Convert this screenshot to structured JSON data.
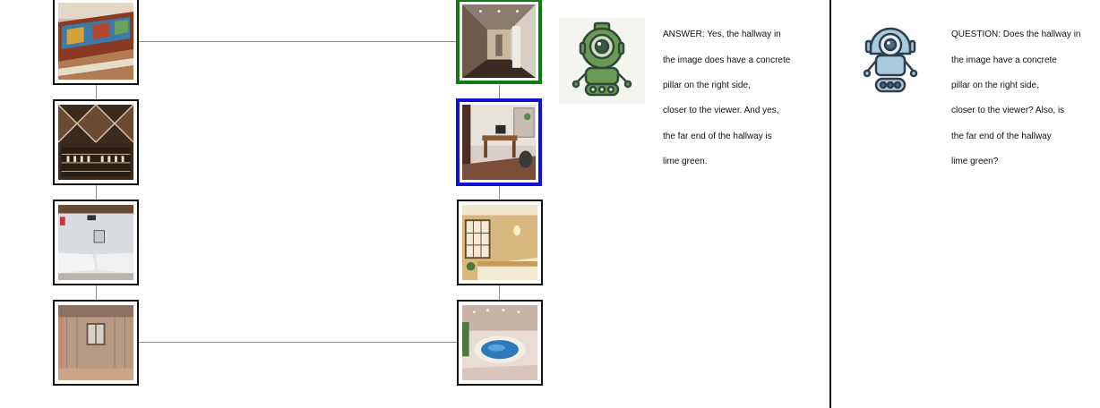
{
  "colors": {
    "selected_primary": "#127a12",
    "selected_secondary": "#1010d8",
    "frame_border": "#111111",
    "connector": "#8c8c8c",
    "answerer_robot": "#6a9a54",
    "questioner_robot": "#a9c9dc"
  },
  "gallery": {
    "left_column": [
      {
        "scene": "lobby-with-mural"
      },
      {
        "scene": "wine-cellar"
      },
      {
        "scene": "bedroom-with-twin-beds"
      },
      {
        "scene": "unfinished-wooden-room"
      }
    ],
    "right_column": [
      {
        "scene": "hallway",
        "selection": "green"
      },
      {
        "scene": "home-office",
        "selection": "blue"
      },
      {
        "scene": "bedroom-with-shoji-screens"
      },
      {
        "scene": "indoor-pool"
      }
    ]
  },
  "chat": {
    "answerer": {
      "icon": "green-robot-icon",
      "lines": [
        "ANSWER: Yes, the hallway in",
        "the image does have a concrete",
        "pillar on the right side,",
        "closer to the viewer. And yes,",
        "the far end of the hallway is",
        "lime green."
      ]
    },
    "questioner": {
      "icon": "blue-robot-icon",
      "lines": [
        "QUESTION: Does the hallway in",
        "the image have a concrete",
        "pillar on the right side,",
        "closer to the viewer? Also, is",
        "the far end of the hallway",
        "lime green?"
      ]
    }
  }
}
